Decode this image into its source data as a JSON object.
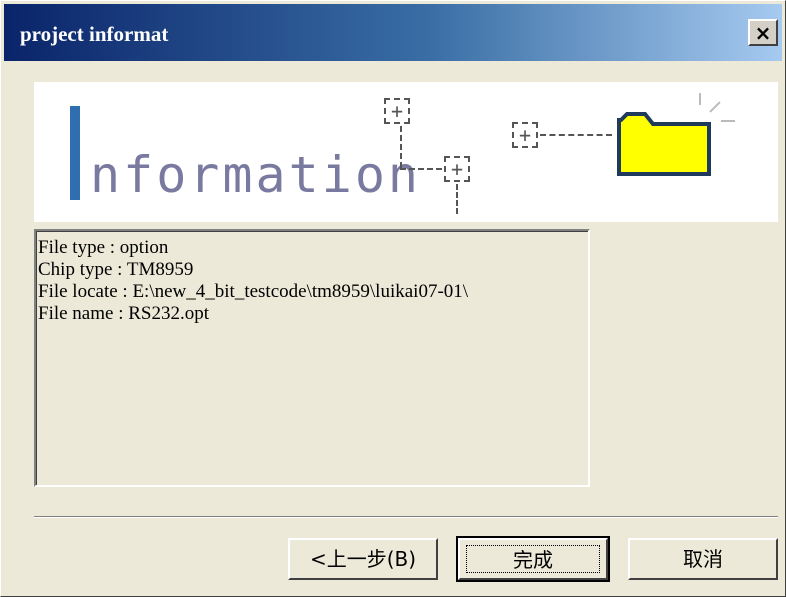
{
  "window": {
    "title": "project informat",
    "close_label": "×"
  },
  "banner": {
    "word": "nformation",
    "plus_glyph": "+"
  },
  "info": {
    "lines": [
      "File type : option",
      "Chip type : TM8959",
      "File locate : E:\\new_4_bit_testcode\\tm8959\\luikai07-01\\",
      "File name : RS232.opt"
    ]
  },
  "buttons": {
    "back_label": "<上一步(B)",
    "finish_label": "完成",
    "cancel_label": "取消"
  },
  "colors": {
    "title_gradient_start": "#0a246a",
    "title_gradient_end": "#a6caf0",
    "banner_accent": "#2f6fb0",
    "folder_fill": "#ffff00",
    "folder_border": "#1f3a5a",
    "dialog_bg": "#ece9d8"
  },
  "icons": {
    "close": "close-icon",
    "folder": "folder-icon",
    "tree_node": "plus-box-icon"
  }
}
